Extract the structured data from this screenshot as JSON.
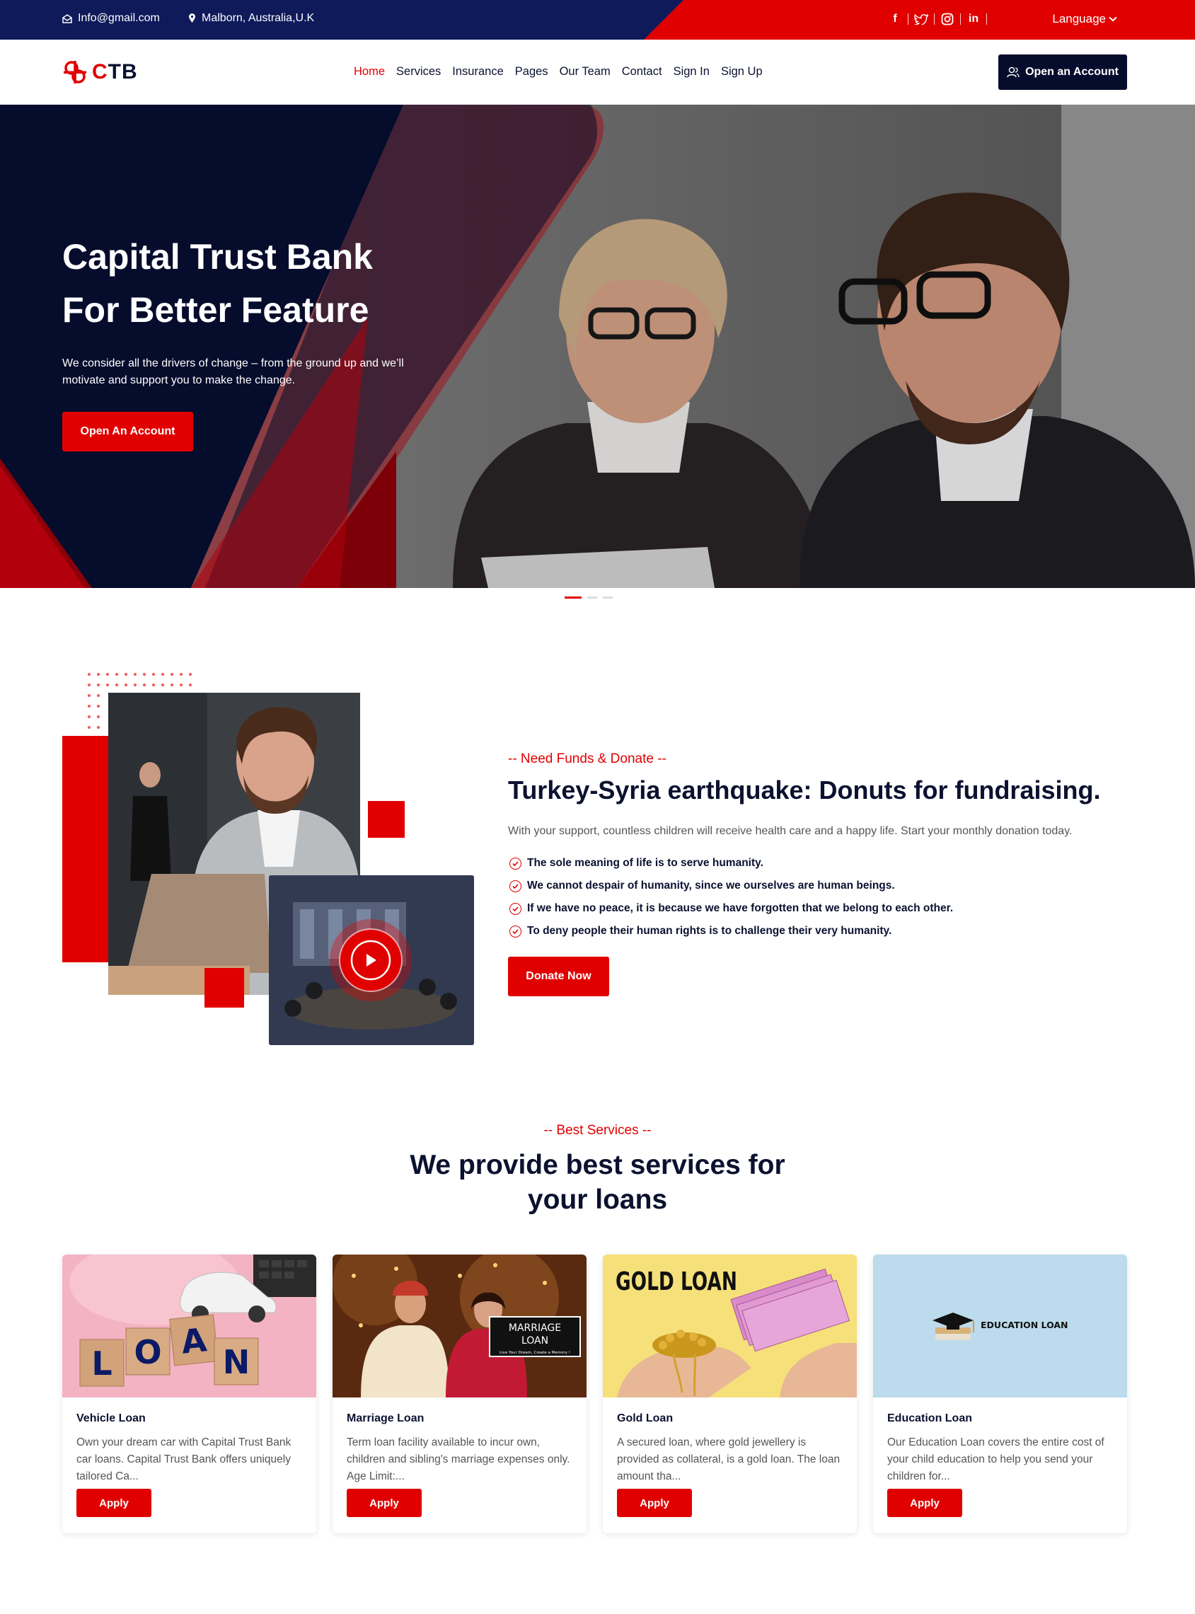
{
  "topbar": {
    "email": "Info@gmail.com",
    "location": "Malborn, Australia,U.K",
    "social": [
      "facebook-icon",
      "twitter-icon",
      "instagram-icon",
      "linkedin-icon"
    ],
    "linkedin_glyph": "in",
    "facebook_glyph": "f",
    "language": "Language"
  },
  "header": {
    "logo_c": "C",
    "logo_tb": "TB",
    "nav": [
      "Home",
      "Services",
      "Insurance",
      "Pages",
      "Our Team",
      "Contact",
      "Sign In",
      "Sign Up"
    ],
    "account_btn": "Open an Account"
  },
  "hero": {
    "title_line1": "Capital Trust Bank",
    "title_line2": "For Better Feature",
    "desc": "We consider all the drivers of change – from the ground up and we’ll motivate and support you to make the change.",
    "button": "Open An Account"
  },
  "donate": {
    "tag": "-- Need Funds & Donate --",
    "title": "Turkey-Syria earthquake: Donuts for fundraising.",
    "text": "With your support, countless children will receive health care and a happy life. Start your monthly donation today.",
    "points": [
      "The sole meaning of life is to serve humanity.",
      "We cannot despair of humanity, since we ourselves are human beings.",
      "If we have no peace, it is because we have forgotten that we belong to each other.",
      "To deny people their human rights is to challenge their very humanity."
    ],
    "button": "Donate Now"
  },
  "services": {
    "tag": "-- Best Services --",
    "title_line1": "We provide best services for",
    "title_line2": "your loans",
    "cards": [
      {
        "title": "Vehicle Loan",
        "desc": "Own your dream car with Capital Trust Bank car loans. Capital Trust Bank offers uniquely tailored Ca...",
        "button": "Apply",
        "img_text": "LOAN"
      },
      {
        "title": "Marriage Loan",
        "desc": "Term loan facility available to incur own, children and sibling's marriage expenses only. Age Limit:...",
        "button": "Apply",
        "img_text": "MARRIAGE LOAN",
        "img_sub": "Live Your Dream, Create a Memory !"
      },
      {
        "title": "Gold Loan",
        "desc": "A secured loan, where gold jewellery is provided as collateral, is a gold loan. The loan amount tha...",
        "button": "Apply",
        "img_text": "GOLD LOAN"
      },
      {
        "title": "Education Loan",
        "desc": "Our Education Loan covers the entire cost of your child education to help you send your children for...",
        "button": "Apply",
        "img_text": "EDUCATION LOAN"
      }
    ]
  },
  "colors": {
    "brand_red": "#e10000",
    "navy": "#060c2c"
  }
}
